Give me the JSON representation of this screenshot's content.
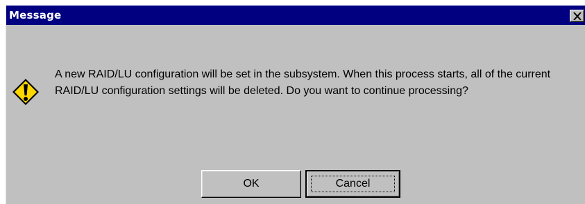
{
  "dialog": {
    "title": "Message",
    "icon": "warning-exclamation-icon",
    "message": "A new RAID/LU configuration will be set in the subsystem. When this process starts, all of the current RAID/LU configuration settings will be deleted. Do you want to continue processing?",
    "buttons": {
      "ok_label": "OK",
      "cancel_label": "Cancel"
    },
    "colors": {
      "titlebar": "#000080",
      "face": "#c0c0c0",
      "icon_fill": "#ffd700"
    }
  }
}
